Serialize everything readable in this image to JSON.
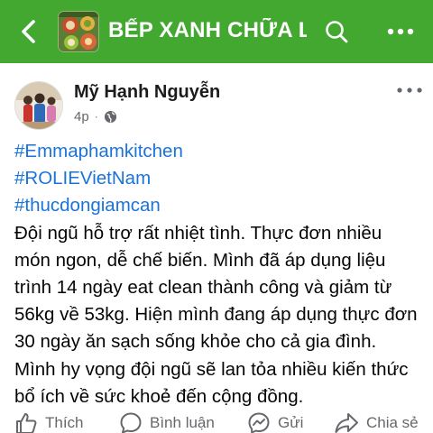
{
  "header": {
    "group_name": "BẾP XANH CHỮA L...",
    "back_icon": "chevron-left-icon",
    "search_icon": "search-icon",
    "more_icon": "more-horizontal-icon",
    "background_color": "#42a830"
  },
  "post": {
    "author": "Mỹ Hạnh Nguyễn",
    "time": "4p",
    "privacy_icon": "globe-icon",
    "options_icon": "more-horizontal-icon",
    "hashtags": [
      "#Emmaphamkitchen",
      "#ROLIEVietNam",
      "#thucdongiamcan"
    ],
    "text": "Đội ngũ hỗ trợ rất nhiệt tình. Thực đơn nhiều món ngon, dễ chế biến. Mình đã áp dụng liệu trình 14 ngày eat clean thành công và giảm từ 56kg về 53kg. Hiện mình đang áp dụng thực đơn 30 ngày ăn sạch sống khỏe cho cả gia đình. Mình hy vọng đội ngũ sẽ lan tỏa nhiều kiến thức bổ ích về sức khoẻ đến cộng đồng.",
    "hashtag_color": "#1a73d9"
  },
  "actions": {
    "like": "Thích",
    "comment": "Bình luận",
    "send": "Gửi",
    "share": "Chia sẻ"
  }
}
